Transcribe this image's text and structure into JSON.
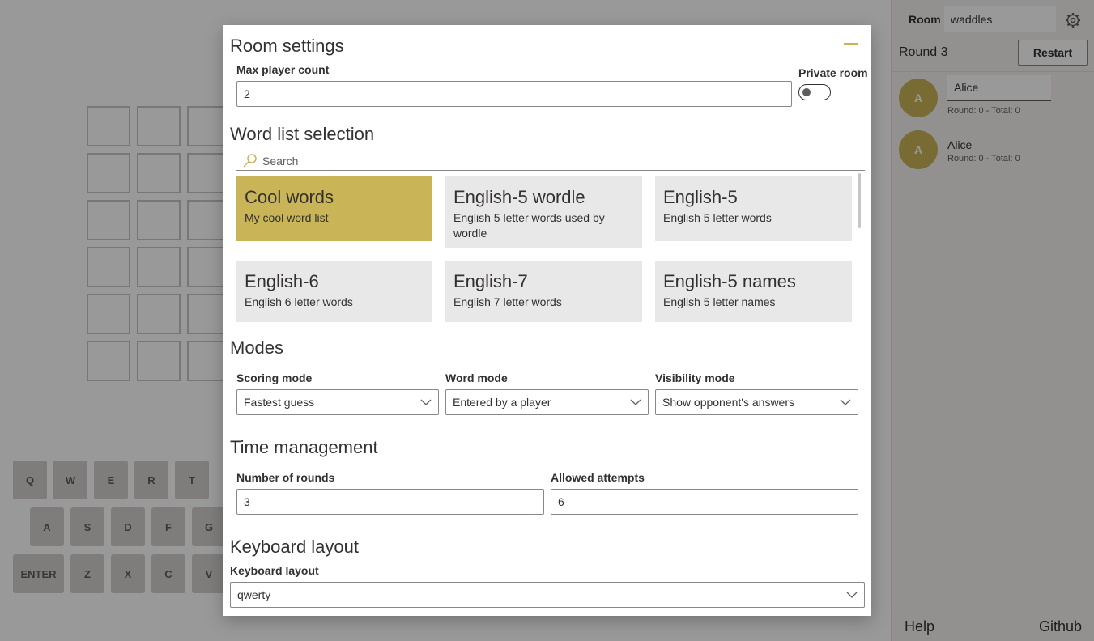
{
  "sidebar": {
    "room_label": "Room",
    "room_value": "waddles",
    "round_label": "Round 3",
    "restart_label": "Restart",
    "players": [
      {
        "initial": "A",
        "name": "Alice",
        "score": "Round: 0 - Total: 0"
      },
      {
        "initial": "A",
        "name": "Alice",
        "score": "Round: 0 - Total: 0"
      }
    ],
    "help_label": "Help",
    "github_label": "Github"
  },
  "keyboard": {
    "row1": [
      "Q",
      "W",
      "E",
      "R",
      "T"
    ],
    "row2": [
      "A",
      "S",
      "D",
      "F",
      "G"
    ],
    "row3": [
      "ENTER",
      "Z",
      "X",
      "C",
      "V"
    ]
  },
  "modal": {
    "title": "Room settings",
    "max_player_label": "Max player count",
    "max_player_value": "2",
    "private_room_label": "Private room",
    "private_room_on": false,
    "wordlist_title": "Word list selection",
    "search_placeholder": "Search",
    "wordlists": [
      {
        "title": "Cool words",
        "desc": "My cool word list",
        "selected": true
      },
      {
        "title": "English-5 wordle",
        "desc": "English 5 letter words used by wordle",
        "selected": false
      },
      {
        "title": "English-5",
        "desc": "English 5 letter words",
        "selected": false
      },
      {
        "title": "English-6",
        "desc": "English 6 letter words",
        "selected": false
      },
      {
        "title": "English-7",
        "desc": "English 7 letter words",
        "selected": false
      },
      {
        "title": "English-5 names",
        "desc": "English 5 letter names",
        "selected": false
      }
    ],
    "modes_title": "Modes",
    "scoring_label": "Scoring mode",
    "scoring_value": "Fastest guess",
    "word_mode_label": "Word mode",
    "word_mode_value": "Entered by a player",
    "visibility_label": "Visibility mode",
    "visibility_value": "Show opponent's answers",
    "time_title": "Time management",
    "rounds_label": "Number of rounds",
    "rounds_value": "3",
    "attempts_label": "Allowed attempts",
    "attempts_value": "6",
    "keyboard_title": "Keyboard layout",
    "keyboard_label": "Keyboard layout",
    "keyboard_value": "qwerty"
  },
  "colors": {
    "accent": "#c9b458",
    "tile_bg": "#e8e8e8",
    "overlay": "rgba(0,0,0,0.4)"
  }
}
